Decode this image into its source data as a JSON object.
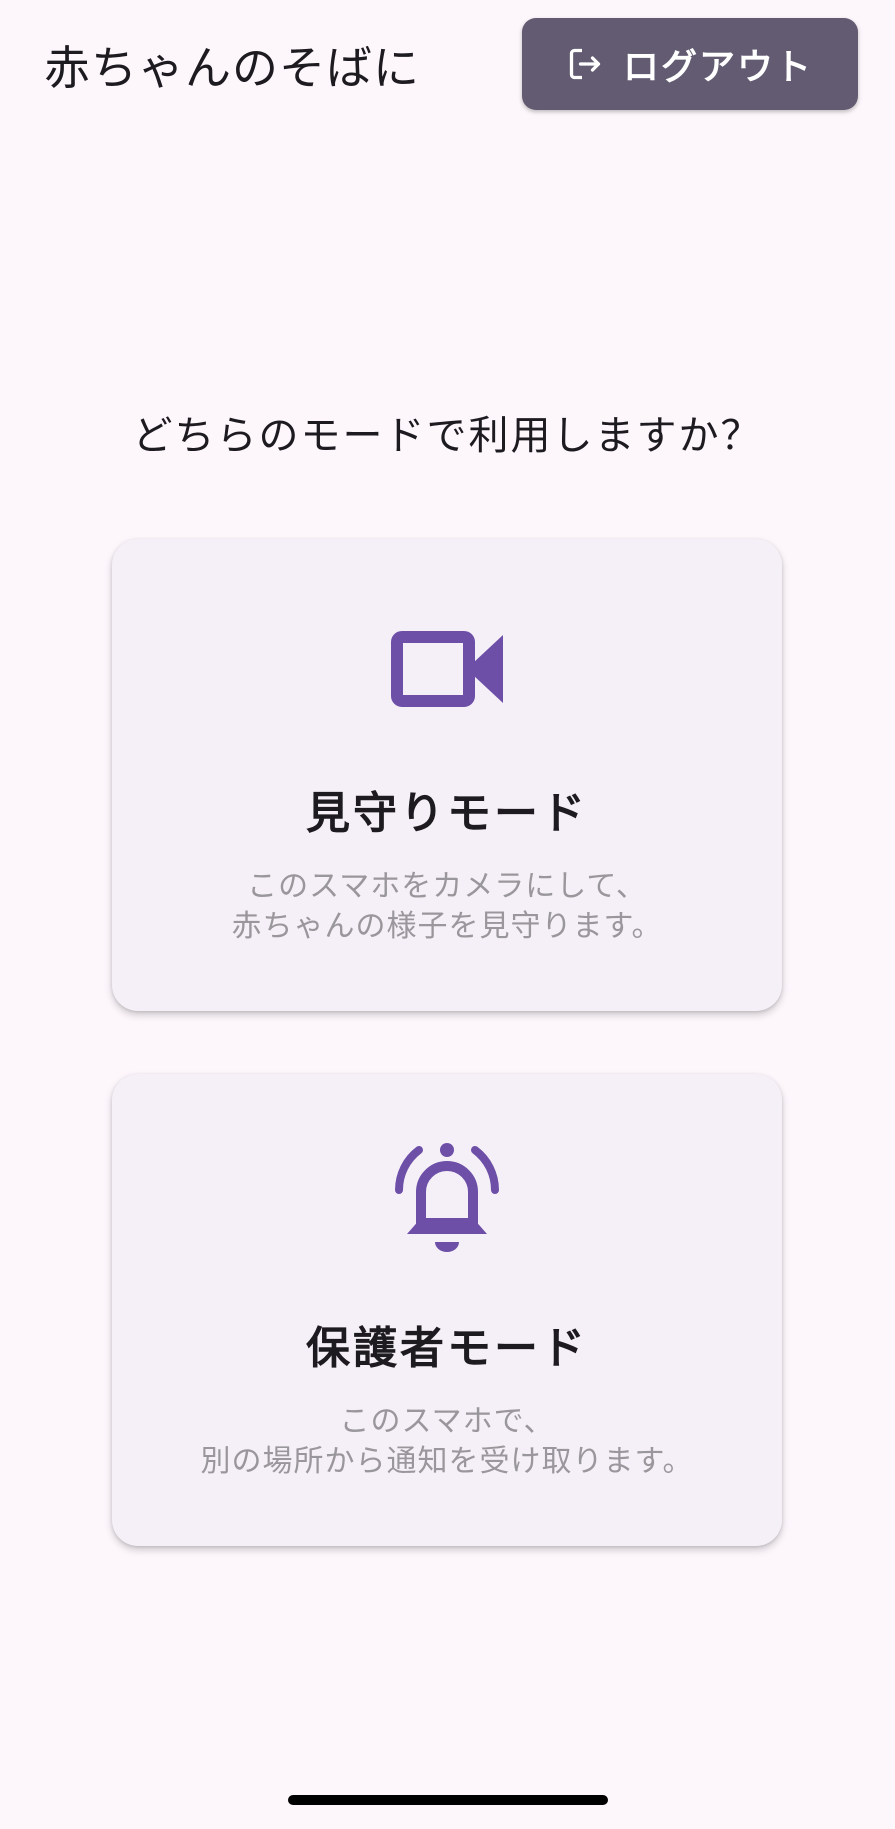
{
  "header": {
    "app_title": "赤ちゃんのそばに",
    "logout_label": "ログアウト"
  },
  "main": {
    "question": "どちらのモードで利用しますか？",
    "modes": [
      {
        "icon": "videocam-icon",
        "title": "見守りモード",
        "description_lines": [
          "このスマホをカメラにして、",
          "赤ちゃんの様子を見守ります。"
        ]
      },
      {
        "icon": "notification-bell-ringing-icon",
        "title": "保護者モード",
        "description_lines": [
          "このスマホで、",
          "別の場所から通知を受け取ります。"
        ]
      }
    ]
  },
  "colors": {
    "background": "#fdf7fc",
    "logout_button": "#625b71",
    "icon_accent": "#6d4fa8",
    "card_background": "#f5f0f7",
    "description_text": "#9a979c"
  }
}
